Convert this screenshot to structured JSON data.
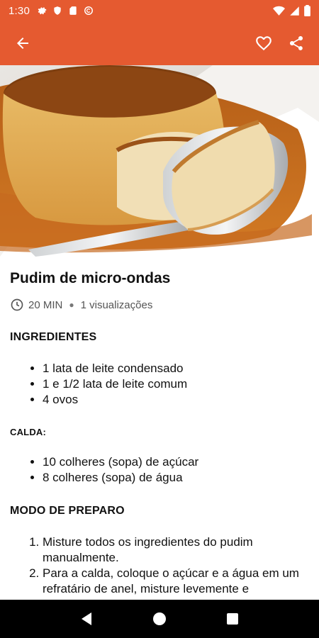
{
  "status_bar": {
    "time": "1:30",
    "icons": [
      "gear-icon",
      "shield-icon",
      "sdcard-icon",
      "circle-c-icon"
    ],
    "right_icons": [
      "wifi-icon",
      "signal-icon",
      "battery-icon"
    ]
  },
  "app_bar": {
    "back_icon": "arrow-left-icon",
    "favorite_icon": "heart-icon",
    "share_icon": "share-icon",
    "color": "#e55a30"
  },
  "recipe": {
    "title": "Pudim de micro-ondas",
    "time": "20 MIN",
    "views": "1 visualizações",
    "ingredients_heading": "INGREDIENTES",
    "ingredients": [
      "1 lata de leite condensado",
      "1 e 1/2 lata de leite comum",
      "4 ovos"
    ],
    "calda_heading": "CALDA:",
    "calda": [
      "10 colheres (sopa) de açúcar",
      "8 colheres (sopa) de água"
    ],
    "prep_heading": "MODO DE PREPARO",
    "steps": [
      "Misture todos os ingredientes do pudim manualmente.",
      "Para a calda, coloque o açúcar e a água em um refratário de anel, misture levemente e"
    ]
  },
  "nav_bar": {
    "back": "back-triangle-icon",
    "home": "home-circle-icon",
    "recents": "recents-square-icon"
  }
}
